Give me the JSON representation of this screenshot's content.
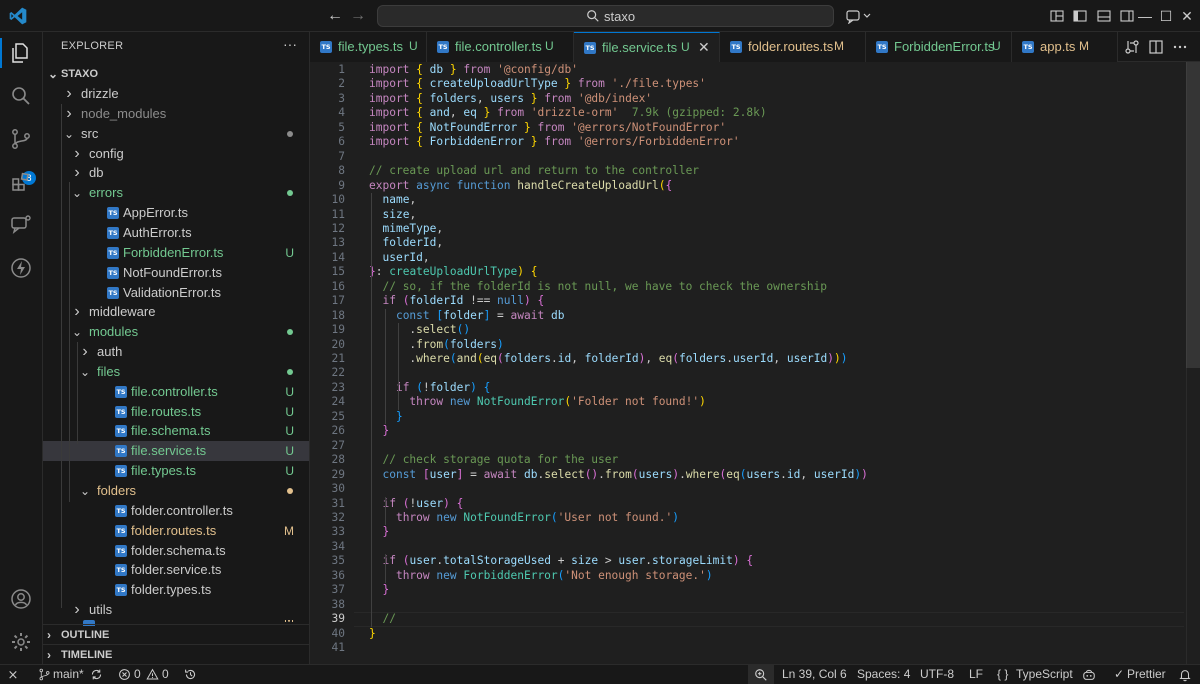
{
  "titlebar": {
    "search_text": "staxo",
    "back_glyph": "←",
    "forward_glyph": "→",
    "minimize_glyph": "—",
    "maximize_glyph": "☐",
    "close_glyph": "✕"
  },
  "activity": {
    "scm_badge": "8"
  },
  "explorer": {
    "title": "EXPLORER",
    "more_glyph": "···",
    "root": "STAXO",
    "tree": [
      {
        "label": "drizzle",
        "status": "",
        "cls": ""
      },
      {
        "label": "node_modules",
        "status": "",
        "cls": "c-ignored"
      },
      {
        "label": "src",
        "status": "",
        "cls": ""
      },
      {
        "label": "config",
        "status": "",
        "cls": ""
      },
      {
        "label": "db",
        "status": "",
        "cls": ""
      },
      {
        "label": "errors",
        "status": "",
        "cls": "c-untracked"
      },
      {
        "label": "AppError.ts",
        "status": "",
        "cls": ""
      },
      {
        "label": "AuthError.ts",
        "status": "",
        "cls": ""
      },
      {
        "label": "ForbiddenError.ts",
        "status": "U",
        "cls": "c-untracked"
      },
      {
        "label": "NotFoundError.ts",
        "status": "",
        "cls": ""
      },
      {
        "label": "ValidationError.ts",
        "status": "",
        "cls": ""
      },
      {
        "label": "middleware",
        "status": "",
        "cls": ""
      },
      {
        "label": "modules",
        "status": "",
        "cls": "c-untracked"
      },
      {
        "label": "auth",
        "status": "",
        "cls": ""
      },
      {
        "label": "files",
        "status": "",
        "cls": "c-untracked"
      },
      {
        "label": "file.controller.ts",
        "status": "U",
        "cls": "c-untracked"
      },
      {
        "label": "file.routes.ts",
        "status": "U",
        "cls": "c-untracked"
      },
      {
        "label": "file.schema.ts",
        "status": "U",
        "cls": "c-untracked"
      },
      {
        "label": "file.service.ts",
        "status": "U",
        "cls": "c-untracked"
      },
      {
        "label": "file.types.ts",
        "status": "U",
        "cls": "c-untracked"
      },
      {
        "label": "folders",
        "status": "",
        "cls": "c-modified"
      },
      {
        "label": "folder.controller.ts",
        "status": "",
        "cls": ""
      },
      {
        "label": "folder.routes.ts",
        "status": "M",
        "cls": "c-modified"
      },
      {
        "label": "folder.schema.ts",
        "status": "",
        "cls": ""
      },
      {
        "label": "folder.service.ts",
        "status": "",
        "cls": ""
      },
      {
        "label": "folder.types.ts",
        "status": "",
        "cls": ""
      },
      {
        "label": "utils",
        "status": "",
        "cls": ""
      }
    ],
    "partial_status": "M",
    "sections": [
      "OUTLINE",
      "TIMELINE"
    ]
  },
  "tabs": [
    {
      "label": "file.types.ts",
      "status": "U"
    },
    {
      "label": "file.controller.ts",
      "status": "U"
    },
    {
      "label": "file.service.ts",
      "status": "U"
    },
    {
      "label": "folder.routes.ts",
      "status": "M"
    },
    {
      "label": "ForbiddenError.ts",
      "status": "U"
    },
    {
      "label": "app.ts",
      "status": "M"
    }
  ],
  "tab_close_glyph": "✕",
  "editor": {
    "active_line": 39,
    "lines": [
      "<span class=\"kw\">import</span> <span class=\"br1\">{</span> <span class=\"var\">db</span> <span class=\"br1\">}</span> <span class=\"kw\">from</span> <span class=\"str\">'@config/db'</span>",
      "<span class=\"kw\">import</span> <span class=\"br1\">{</span> <span class=\"var\">createUploadUrlType</span> <span class=\"br1\">}</span> <span class=\"kw\">from</span> <span class=\"str\">'./file.types'</span>",
      "<span class=\"kw\">import</span> <span class=\"br1\">{</span> <span class=\"var\">folders</span>, <span class=\"var\">users</span> <span class=\"br1\">}</span> <span class=\"kw\">from</span> <span class=\"str\">'@db/index'</span>",
      "<span class=\"kw\">import</span> <span class=\"br1\">{</span> <span class=\"var\">and</span>, <span class=\"var\">eq</span> <span class=\"br1\">}</span> <span class=\"kw\">from</span> <span class=\"str\">'drizzle-orm'</span>  <span class=\"hint\">7.9k (gzipped: 2.8k)</span>",
      "<span class=\"kw\">import</span> <span class=\"br1\">{</span> <span class=\"var\">NotFoundError</span> <span class=\"br1\">}</span> <span class=\"kw\">from</span> <span class=\"str\">'@errors/NotFoundError'</span>",
      "<span class=\"kw\">import</span> <span class=\"br1\">{</span> <span class=\"var\">ForbiddenError</span> <span class=\"br1\">}</span> <span class=\"kw\">from</span> <span class=\"str\">'@errors/ForbiddenError'</span>",
      "",
      "<span class=\"cm\">// create upload url and return to the controller</span>",
      "<span class=\"kw\">export</span> <span class=\"kb\">async</span> <span class=\"kb\">function</span> <span class=\"fn\">handleCreateUploadUrl</span><span class=\"br1\">(</span><span class=\"br2\">{</span>",
      "  <span class=\"var\">name</span>,",
      "  <span class=\"var\">size</span>,",
      "  <span class=\"var\">mimeType</span>,",
      "  <span class=\"var\">folderId</span>,",
      "  <span class=\"var\">userId</span>,",
      "<span class=\"br2\">}</span>: <span class=\"ty\">createUploadUrlType</span><span class=\"br1\">)</span> <span class=\"br1\">{</span>",
      "  <span class=\"cm\">// so, if the folderId is not null, we have to check the ownership</span>",
      "  <span class=\"kw\">if</span> <span class=\"br2\">(</span><span class=\"var\">folderId</span> !== <span class=\"kb\">null</span><span class=\"br2\">)</span> <span class=\"br2\">{</span>",
      "    <span class=\"kb\">const</span> <span class=\"br3\">[</span><span class=\"var\">folder</span><span class=\"br3\">]</span> = <span class=\"kw\">await</span> <span class=\"var\">db</span>",
      "      .<span class=\"fn\">select</span><span class=\"br3\">()</span>",
      "      .<span class=\"fn\">from</span><span class=\"br3\">(</span><span class=\"var\">folders</span><span class=\"br3\">)</span>",
      "      .<span class=\"fn\">where</span><span class=\"br3\">(</span><span class=\"fn\">and</span><span class=\"br1\">(</span><span class=\"fn\">eq</span><span class=\"br2\">(</span><span class=\"var\">folders</span>.<span class=\"var\">id</span>, <span class=\"var\">folderId</span><span class=\"br2\">)</span>, <span class=\"fn\">eq</span><span class=\"br2\">(</span><span class=\"var\">folders</span>.<span class=\"var\">userId</span>, <span class=\"var\">userId</span><span class=\"br2\">)</span><span class=\"br1\">)</span><span class=\"br3\">)</span>",
      "",
      "    <span class=\"kw\">if</span> <span class=\"br3\">(</span>!<span class=\"var\">folder</span><span class=\"br3\">)</span> <span class=\"br3\">{</span>",
      "      <span class=\"kw\">throw</span> <span class=\"kb\">new</span> <span class=\"ty\">NotFoundError</span><span class=\"br1\">(</span><span class=\"str\">'Folder not found!'</span><span class=\"br1\">)</span>",
      "    <span class=\"br3\">}</span>",
      "  <span class=\"br2\">}</span>",
      "",
      "  <span class=\"cm\">// check storage quota for the user</span>",
      "  <span class=\"kb\">const</span> <span class=\"br2\">[</span><span class=\"var\">user</span><span class=\"br2\">]</span> = <span class=\"kw\">await</span> <span class=\"var\">db</span>.<span class=\"fn\">select</span><span class=\"br2\">()</span>.<span class=\"fn\">from</span><span class=\"br2\">(</span><span class=\"var\">users</span><span class=\"br2\">)</span>.<span class=\"fn\">where</span><span class=\"br2\">(</span><span class=\"fn\">eq</span><span class=\"br3\">(</span><span class=\"var\">users</span>.<span class=\"var\">id</span>, <span class=\"var\">userId</span><span class=\"br3\">)</span><span class=\"br2\">)</span>",
      "",
      "  <span class=\"kw\">if</span> <span class=\"br2\">(</span>!<span class=\"var\">user</span><span class=\"br2\">)</span> <span class=\"br2\">{</span>",
      "    <span class=\"kw\">throw</span> <span class=\"kb\">new</span> <span class=\"ty\">NotFoundError</span><span class=\"br3\">(</span><span class=\"str\">'User not found.'</span><span class=\"br3\">)</span>",
      "  <span class=\"br2\">}</span>",
      "",
      "  <span class=\"kw\">if</span> <span class=\"br2\">(</span><span class=\"var\">user</span>.<span class=\"var\">totalStorageUsed</span> + <span class=\"var\">size</span> &gt; <span class=\"var\">user</span>.<span class=\"var\">storageLimit</span><span class=\"br2\">)</span> <span class=\"br2\">{</span>",
      "    <span class=\"kw\">throw</span> <span class=\"kb\">new</span> <span class=\"ty\">ForbiddenError</span><span class=\"br3\">(</span><span class=\"str\">'Not enough storage.'</span><span class=\"br3\">)</span>",
      "  <span class=\"br2\">}</span>",
      "",
      "  <span class=\"cm\">//</span>",
      "<span class=\"br1\">}</span>",
      ""
    ]
  },
  "statusbar": {
    "remote_glyph": "⨯",
    "branch": "main*",
    "errors": "0",
    "warnings": "0",
    "cursor": "Ln 39, Col 6",
    "spaces": "Spaces: 4",
    "encoding": "UTF-8",
    "eol": "LF",
    "language_braces": "{ }",
    "language": "TypeScript",
    "prettier": "Prettier",
    "prettier_check": "✓"
  },
  "colors": {
    "accent": "#0078d4",
    "untracked": "#73c991",
    "modified": "#e2c08d",
    "ts_badge": "#3178c6"
  }
}
